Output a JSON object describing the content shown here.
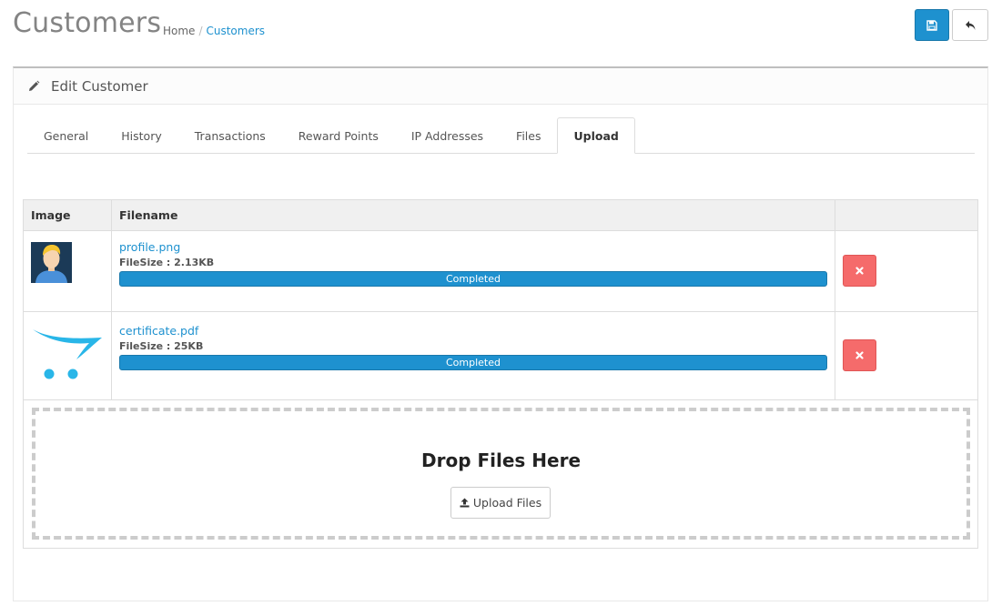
{
  "header": {
    "title": "Customers",
    "breadcrumb": [
      {
        "label": "Home"
      },
      {
        "label": "Customers"
      }
    ],
    "separator": "/"
  },
  "toolbar": {
    "save_icon": "floppy-disk-icon",
    "back_icon": "reply-arrow-icon",
    "accent": "#1e91cf"
  },
  "panel": {
    "title": "Edit Customer",
    "icon": "pencil-icon"
  },
  "tabs": [
    {
      "label": "General",
      "active": false
    },
    {
      "label": "History",
      "active": false
    },
    {
      "label": "Transactions",
      "active": false
    },
    {
      "label": "Reward Points",
      "active": false
    },
    {
      "label": "IP Addresses",
      "active": false
    },
    {
      "label": "Files",
      "active": false
    },
    {
      "label": "Upload",
      "active": true
    }
  ],
  "table": {
    "headers": [
      "Image",
      "Filename",
      ""
    ],
    "rows": [
      {
        "thumbnail": "user-avatar-icon",
        "filename": "profile.png",
        "filesize": "FileSize : 2.13KB",
        "progress_label": "Completed",
        "progress": 1.0
      },
      {
        "thumbnail": "shopping-cart-logo-icon",
        "filename": "certificate.pdf",
        "filesize": "FileSize : 25KB",
        "progress_label": "Completed",
        "progress": 1.0
      }
    ]
  },
  "dropzone": {
    "title": "Drop Files Here",
    "button_label": "Upload Files",
    "button_icon": "upload-icon"
  },
  "colors": {
    "danger": "#f56b6b",
    "progress": "#1e91cf"
  }
}
